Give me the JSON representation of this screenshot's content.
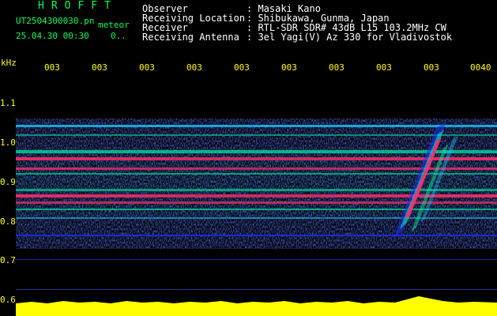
{
  "header": {
    "title": "HROFFT",
    "filename": "UT2504300030.pn",
    "mode": "meteor",
    "datetime": "25.04.30 00:30",
    "datetime_extra": "0.."
  },
  "station": {
    "labels": [
      "Observer",
      "Receiving Location",
      "Receiver",
      "Receiving Antenna"
    ],
    "values": [
      ": Masaki Kano",
      ": Shibukawa, Gunma, Japan",
      ": RTL-SDR SDR# 43dB L15 103.2MHz CW",
      ": 3el Yagi(V) Az 330 for Vladivostok"
    ]
  },
  "axis": {
    "unit": "kHz",
    "y_ticks": [
      "1.1",
      "1.0",
      "0.9",
      "0.8",
      "0.7",
      "0.6"
    ],
    "x_ticks": [
      "003",
      "003",
      "003",
      "003",
      "003",
      "003",
      "003",
      "003",
      "003",
      "0040"
    ]
  },
  "colors": {
    "background": "#000000",
    "header_green": "#00ff5a",
    "tick_yellow": "#ffff00",
    "text_white": "#ffffff",
    "signal_low": "#1a2dff",
    "signal_mid": "#00ffb0",
    "signal_high": "#ff2a6a",
    "power_bar": "#ffff00"
  }
}
